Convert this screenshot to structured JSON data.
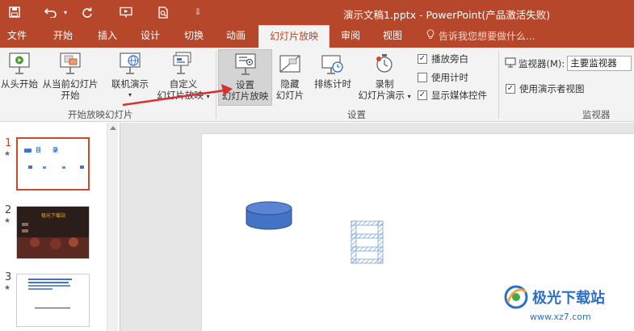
{
  "titlebar": {
    "title": "演示文稿1.pptx - PowerPoint(产品激活失败)",
    "save_icon": "save-icon",
    "undo_icon": "undo-icon",
    "redo_icon": "redo-icon",
    "start_from_beginning_icon": "present-from-start-icon",
    "print_preview_icon": "print-preview-icon",
    "customize_icon": "customize-qat-icon",
    "background_color": "#b7472a"
  },
  "tabs": [
    {
      "label": "文件"
    },
    {
      "label": "开始"
    },
    {
      "label": "插入"
    },
    {
      "label": "设计"
    },
    {
      "label": "切换"
    },
    {
      "label": "动画"
    },
    {
      "label": "幻灯片放映",
      "active": true
    },
    {
      "label": "审阅"
    },
    {
      "label": "视图"
    }
  ],
  "tell_me": {
    "text": "告诉我您想要做什么...",
    "icon": "lightbulb-icon"
  },
  "ribbon": {
    "start_group": {
      "label": "开始放映幻灯片",
      "from_beginning": "从头开始",
      "from_current_line1": "从当前幻灯片",
      "from_current_line2": "开始",
      "online": "联机演示",
      "custom_line1": "自定义",
      "custom_line2": "幻灯片放映"
    },
    "setup_group": {
      "label": "设置",
      "setup_line1": "设置",
      "setup_line2": "幻灯片放映",
      "hide_line1": "隐藏",
      "hide_line2": "幻灯片",
      "rehearse": "排练计时",
      "record_line1": "录制",
      "record_line2": "幻灯片演示",
      "play_narrations": {
        "label": "播放旁白",
        "checked": true
      },
      "use_timings": {
        "label": "使用计时",
        "checked": false
      },
      "show_media_controls": {
        "label": "显示媒体控件",
        "checked": true
      }
    },
    "monitors_group": {
      "label": "监视器",
      "monitor_label": "监视器(M):",
      "monitor_value": "主要监视器",
      "presenter_view": {
        "label": "使用演示者视图",
        "checked": true
      }
    }
  },
  "thumbnails": [
    {
      "number": "1",
      "star": "★",
      "active": true,
      "title": "目　　录"
    },
    {
      "number": "2",
      "star": "★",
      "active": false,
      "title": "极光下载站"
    },
    {
      "number": "3",
      "star": "★",
      "active": false
    }
  ],
  "watermark": {
    "text": "极光下载站",
    "url": "www.xz7.com"
  },
  "colors": {
    "accent": "#b7472a",
    "shape_blue": "#4472c4",
    "annotation_arrow": "#d9302f"
  }
}
